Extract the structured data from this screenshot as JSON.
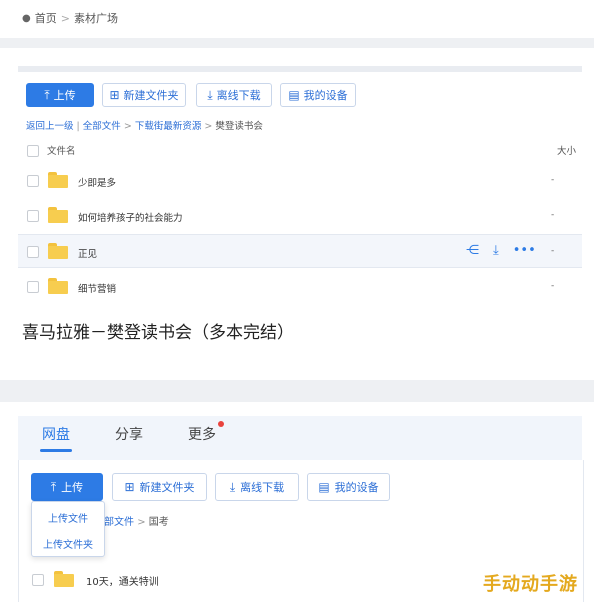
{
  "top_breadcrumb": {
    "home": "首页",
    "separator": ">",
    "current": "素材广场"
  },
  "toolbar1": {
    "upload": "上传",
    "new_folder": "新建文件夹",
    "offline_download": "离线下载",
    "my_devices": "我的设备"
  },
  "path1": {
    "back": "返回上一级",
    "sep": "|",
    "all_files": "全部文件",
    "arrow": ">",
    "folder": "下载街最新资源",
    "current": "樊登读书会"
  },
  "list_header": {
    "name": "文件名",
    "size": "大小"
  },
  "files1": [
    {
      "name": "少即是多",
      "size": "-"
    },
    {
      "name": "如何培养孩子的社会能力",
      "size": "-"
    },
    {
      "name": "正见",
      "size": "-"
    },
    {
      "name": "细节营销",
      "size": "-"
    }
  ],
  "caption": "喜马拉雅－樊登读书会（多本完结）",
  "tabs": {
    "disk": "网盘",
    "share": "分享",
    "more": "更多"
  },
  "toolbar2": {
    "upload": "上传",
    "new_folder": "新建文件夹",
    "offline_download": "离线下载",
    "my_devices": "我的设备"
  },
  "upload_menu": {
    "upload_file": "上传文件",
    "upload_folder": "上传文件夹"
  },
  "path2": {
    "all_files_partial": "部文件",
    "arrow": ">",
    "current": "国考"
  },
  "files2": [
    {
      "name": "10天，通关特训"
    }
  ],
  "watermark": "手动动手游",
  "colors": {
    "accent": "#2d7be5",
    "folder": "#f7cd4f",
    "badge": "#e9433d",
    "watermark": "#e4a91f"
  }
}
